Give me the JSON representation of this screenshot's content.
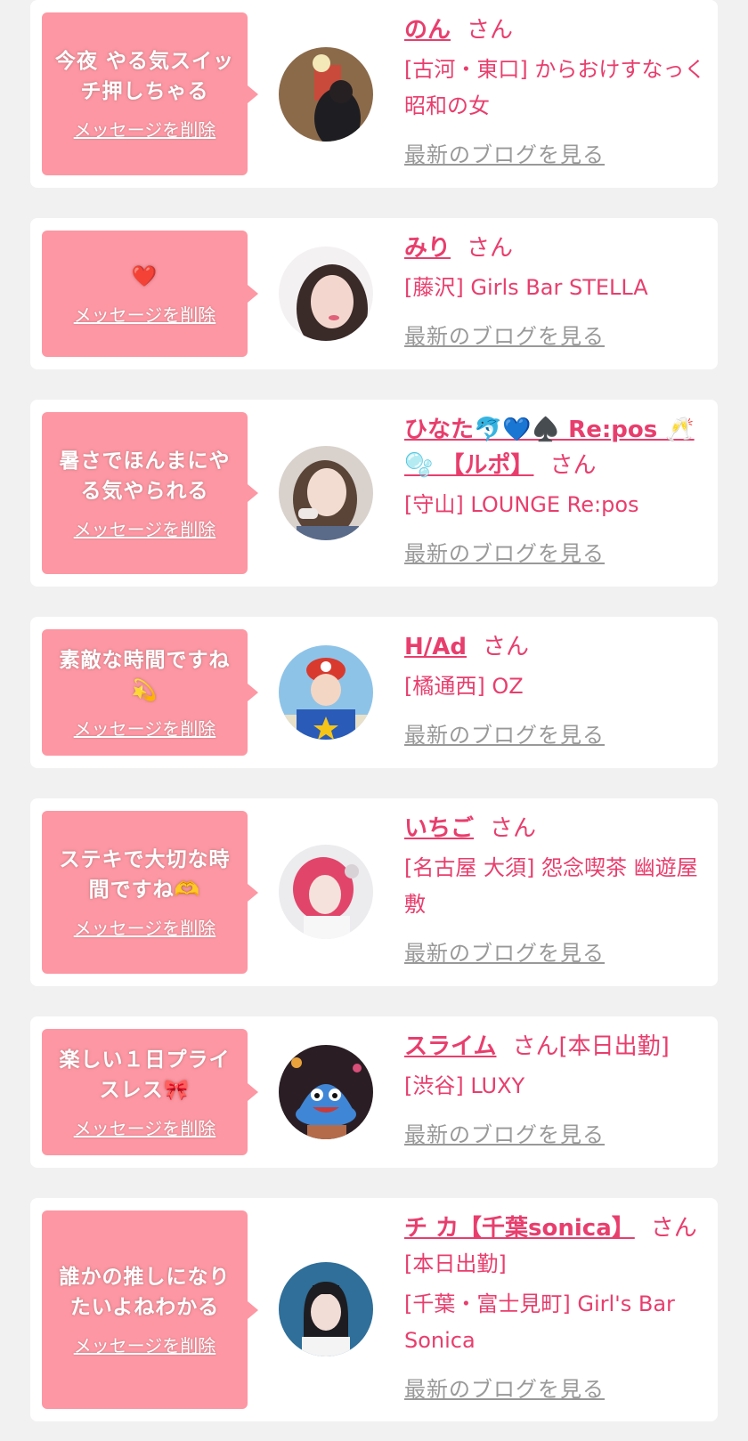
{
  "favorites": [
    {
      "message": "今夜 やる気スイッチ押しちゃる",
      "delete_label": "メッセージを削除",
      "name": "のん",
      "honorific": "さん",
      "status": "",
      "shop": "[古河・東口] からおけすなっく 昭和の女",
      "blog_link": "最新のブログを見る"
    },
    {
      "message": "❤️",
      "delete_label": "メッセージを削除",
      "name": "みり",
      "honorific": "さん",
      "status": "",
      "shop": "[藤沢] Girls Bar STELLA",
      "blog_link": "最新のブログを見る"
    },
    {
      "message": "暑さでほんまにやる気やられる",
      "delete_label": "メッセージを削除",
      "name": "ひなた🐬💙♠️ Re:pos 🥂🫧 【ルポ】",
      "honorific": "さん",
      "status": "",
      "shop": "[守山] LOUNGE Re:pos",
      "blog_link": "最新のブログを見る"
    },
    {
      "message": "素敵な時間ですね💫",
      "delete_label": "メッセージを削除",
      "name": "H/Ad",
      "honorific": "さん",
      "status": "",
      "shop": "[橘通西] OZ",
      "blog_link": "最新のブログを見る"
    },
    {
      "message": "ステキで大切な時間ですね🫶",
      "delete_label": "メッセージを削除",
      "name": "いちご",
      "honorific": "さん",
      "status": "",
      "shop": "[名古屋 大須] 怨念喫茶 幽遊屋敷",
      "blog_link": "最新のブログを見る"
    },
    {
      "message": "楽しい１日プライスレス🎀",
      "delete_label": "メッセージを削除",
      "name": "スライム",
      "honorific": "さん",
      "status": "[本日出勤]",
      "shop": "[渋谷] LUXY",
      "blog_link": "最新のブログを見る"
    },
    {
      "message": "誰かの推しになりたいよねわかる",
      "delete_label": "メッセージを削除",
      "name": "チ カ【千葉sonica】",
      "honorific": "さん",
      "status": "[本日出勤]",
      "shop": "[千葉・富士見町] Girl's Bar Sonica",
      "blog_link": "最新のブログを見る"
    }
  ]
}
